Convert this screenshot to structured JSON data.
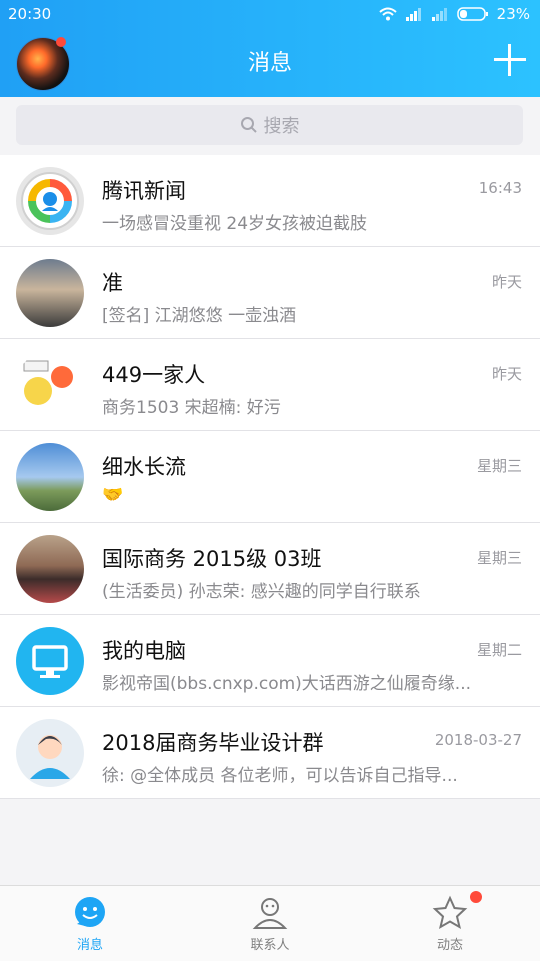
{
  "status_bar": {
    "time": "20:30",
    "battery": "23%"
  },
  "header": {
    "title": "消息"
  },
  "search": {
    "placeholder": "搜索"
  },
  "conversations": [
    {
      "name": "腾讯新闻",
      "preview": "一场感冒没重视 24岁女孩被迫截肢",
      "time": "16:43"
    },
    {
      "name": "准",
      "preview": "[签名] 江湖悠悠 一壶浊酒",
      "time": "昨天"
    },
    {
      "name": "449一家人",
      "preview": "商务1503 宋超楠: 好污",
      "time": "昨天"
    },
    {
      "name": "细水长流",
      "preview": "🤝",
      "time": "星期三"
    },
    {
      "name": "国际商务 2015级 03班",
      "preview": "(生活委员) 孙志荣: 感兴趣的同学自行联系",
      "time": "星期三"
    },
    {
      "name": "我的电脑",
      "preview": "影视帝国(bbs.cnxp.com)大话西游之仙履奇缘...",
      "time": "星期二"
    },
    {
      "name": "2018届商务毕业设计群",
      "preview": "徐: @全体成员  各位老师，可以告诉自己指导...",
      "time": "2018-03-27"
    }
  ],
  "tabs": [
    {
      "label": "消息",
      "icon": "chat-bubble-icon",
      "active": true
    },
    {
      "label": "联系人",
      "icon": "contacts-icon",
      "active": false
    },
    {
      "label": "动态",
      "icon": "star-icon",
      "active": false
    }
  ],
  "colors": {
    "brand_blue": "#1ea5f5",
    "badge_red": "#ff4a3a"
  }
}
